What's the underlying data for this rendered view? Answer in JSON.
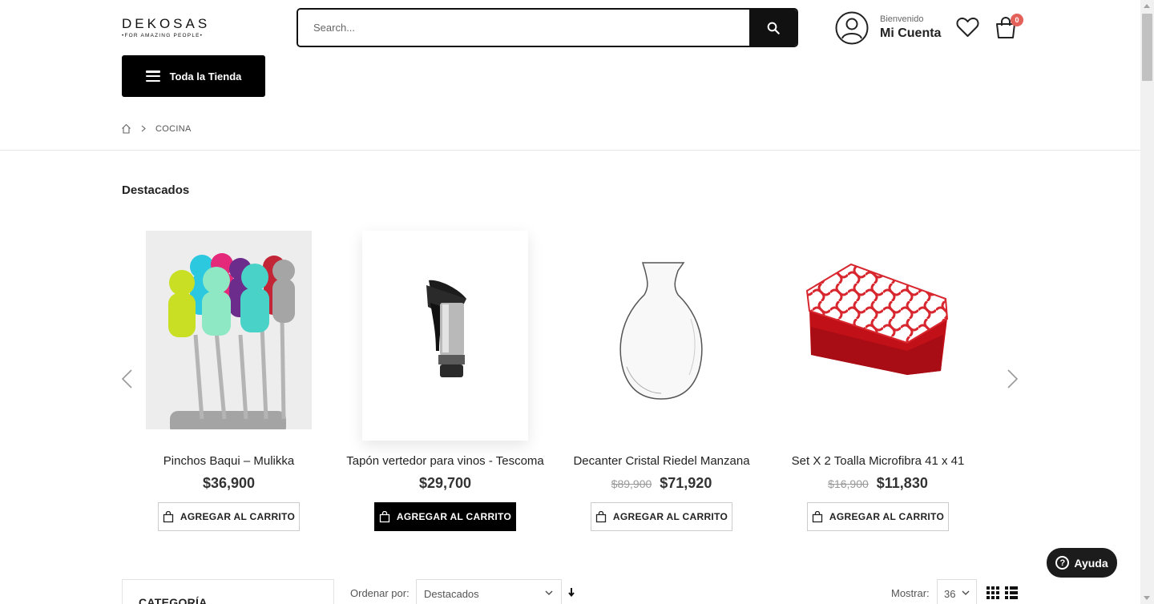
{
  "header": {
    "logo_main": "DEKOSAS",
    "logo_sub": "•FOR AMAZING PEOPLE•",
    "search_placeholder": "Search...",
    "welcome": "Bienvenido",
    "account": "Mi Cuenta",
    "cart_count": "0",
    "store_button": "Toda la Tienda"
  },
  "breadcrumb": {
    "current": "COCINA"
  },
  "featured": {
    "title": "Destacados",
    "products": [
      {
        "name": "Pinchos Baqui – Mulikka",
        "old_price": "",
        "price": "$36,900",
        "button": "AGREGAR AL CARRITO"
      },
      {
        "name": "Tapón vertedor para vinos - Tescoma",
        "old_price": "",
        "price": "$29,700",
        "button": "AGREGAR AL CARRITO"
      },
      {
        "name": "Decanter Cristal Riedel Manzana",
        "old_price": "$89,900",
        "price": "$71,920",
        "button": "AGREGAR AL CARRITO"
      },
      {
        "name": "Set X 2 Toalla Microfibra 41 x 41",
        "old_price": "$16,900",
        "price": "$11,830",
        "button": "AGREGAR AL CARRITO"
      }
    ]
  },
  "sidebar": {
    "category_title": "CATEGORÍA"
  },
  "toolbar": {
    "order_label": "Ordenar por:",
    "order_value": "Destacados",
    "show_label": "Mostrar:",
    "show_value": "36"
  },
  "help": {
    "label": "Ayuda"
  },
  "colors": {
    "accent": "#000000",
    "badge": "#e36159",
    "help": "#1c1c1c"
  }
}
